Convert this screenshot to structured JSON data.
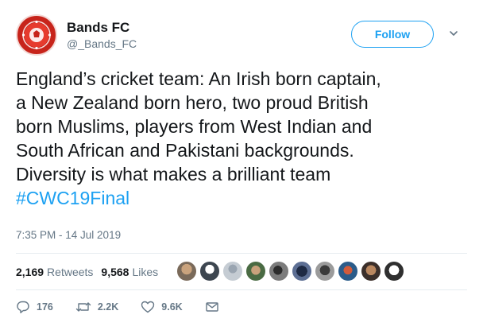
{
  "account": {
    "display_name": "Bands FC",
    "handle": "@_Bands_FC",
    "avatar_icon": "team-crest-icon"
  },
  "follow_label": "Follow",
  "tweet": {
    "lines": [
      "England’s cricket team: An Irish born captain,",
      "a New Zealand born hero, two proud British",
      "born Muslims, players from West Indian and",
      "South African and Pakistani backgrounds.",
      "Diversity is what makes a brilliant team"
    ],
    "hashtag": "#CWC19Final",
    "timestamp": "7:35 PM - 14 Jul 2019"
  },
  "stats": {
    "retweets_count": "2,169",
    "retweets_label": "Retweets",
    "likes_count": "9,568",
    "likes_label": "Likes"
  },
  "likers_count": 10,
  "actions": {
    "replies": "176",
    "retweets": "2.2K",
    "likes": "9.6K"
  },
  "colors": {
    "accent": "#1da1f2",
    "text": "#14171a",
    "muted": "#657786",
    "crest": "#d9302a"
  }
}
